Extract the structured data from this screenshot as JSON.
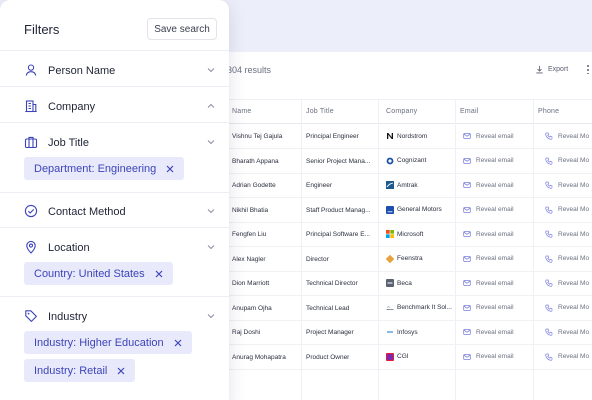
{
  "results": {
    "count_text": "304 results",
    "export_label": "Export",
    "columns": [
      "Name",
      "Job Title",
      "Company",
      "Email",
      "Phone"
    ],
    "rows": [
      {
        "name": "Vishnu Tej Gajula",
        "title": "Principal Engineer",
        "company": "Nordstrom",
        "logo": "nordstrom-logo",
        "email": "Reveal email",
        "phone": "Reveal Mo"
      },
      {
        "name": "Bharath Appana",
        "title": "Senior Project Mana...",
        "company": "Cognizant",
        "logo": "cognizant-logo",
        "email": "Reveal email",
        "phone": "Reveal Mo"
      },
      {
        "name": "Adrian Godette",
        "title": "Engineer",
        "company": "Amtrak",
        "logo": "amtrak-logo",
        "email": "Reveal email",
        "phone": "Reveal Mo"
      },
      {
        "name": "Nikhil Bhatia",
        "title": "Staff Product Manag...",
        "company": "General Motors",
        "logo": "gm-logo",
        "email": "Reveal email",
        "phone": "Reveal Mo"
      },
      {
        "name": "Fengfen Liu",
        "title": "Principal Software E...",
        "company": "Microsoft",
        "logo": "microsoft-logo",
        "email": "Reveal email",
        "phone": "Reveal Mo"
      },
      {
        "name": "Alex Nagler",
        "title": "Director",
        "company": "Feenstra",
        "logo": "feenstra-logo",
        "email": "Reveal email",
        "phone": "Reveal Mo"
      },
      {
        "name": "Dion Marriott",
        "title": "Technical Director",
        "company": "Beca",
        "logo": "beca-logo",
        "email": "Reveal email",
        "phone": "Reveal Mo"
      },
      {
        "name": "Anupam Ojha",
        "title": "Technical Lead",
        "company": "Benchmark It Sol...",
        "logo": "benchmark-logo",
        "email": "Reveal email",
        "phone": "Reveal Mo"
      },
      {
        "name": "Raj Doshi",
        "title": "Project Manager",
        "company": "Infosys",
        "logo": "infosys-logo",
        "email": "Reveal email",
        "phone": "Reveal Mo"
      },
      {
        "name": "Anurag Mohapatra",
        "title": "Product Owner",
        "company": "CGI",
        "logo": "cgi-logo",
        "email": "Reveal email",
        "phone": "Reveal Mo"
      }
    ]
  },
  "filters": {
    "title": "Filters",
    "save_label": "Save search",
    "sections": [
      {
        "label": "Person Name",
        "icon": "person-icon",
        "expanded": false
      },
      {
        "label": "Company",
        "icon": "building-icon",
        "expanded": true
      },
      {
        "label": "Job Title",
        "icon": "briefcase-icon",
        "expanded": false,
        "chips": [
          "Department: Engineering"
        ]
      },
      {
        "label": "Contact Method",
        "icon": "check-circle-icon",
        "expanded": false
      },
      {
        "label": "Location",
        "icon": "location-pin-icon",
        "expanded": false,
        "chips": [
          "Country: United States"
        ]
      },
      {
        "label": "Industry",
        "icon": "tag-icon",
        "expanded": false,
        "chips": [
          "Industry: Higher Education",
          "Industry: Retail"
        ]
      }
    ]
  },
  "colors": {
    "accent": "#3d44b8",
    "chip_bg": "#e8eafb",
    "page_bg": "#eceef9"
  }
}
